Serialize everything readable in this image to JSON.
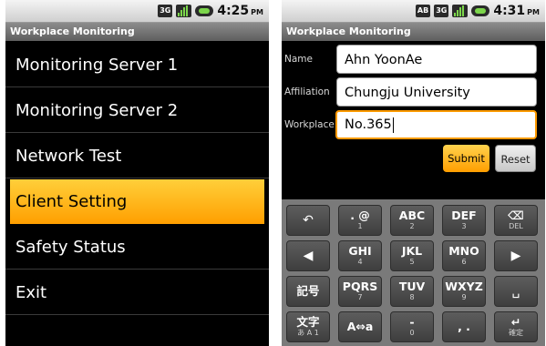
{
  "left_screen": {
    "status": {
      "network": "3G",
      "time": "4:25",
      "ampm": "PM"
    },
    "title": "Workplace Monitoring",
    "menu": [
      {
        "label": "Monitoring Server 1"
      },
      {
        "label": "Monitoring Server 2"
      },
      {
        "label": "Network Test"
      },
      {
        "label": "Client Setting",
        "selected": true
      },
      {
        "label": "Safety Status"
      },
      {
        "label": "Exit"
      }
    ]
  },
  "right_screen": {
    "status": {
      "badge": "AB",
      "network": "3G",
      "time": "4:31",
      "ampm": "PM"
    },
    "title": "Workplace Monitoring",
    "form": {
      "name_label": "Name",
      "name_value": "Ahn YoonAe",
      "affiliation_label": "Affiliation",
      "affiliation_value": "Chungju University",
      "workplace_label": "Workplace",
      "workplace_value": "No.365"
    },
    "buttons": {
      "submit": "Submit",
      "reset": "Reset"
    },
    "keyboard": {
      "row1": [
        {
          "icon": "undo-arrow-icon",
          "glyph": "↶"
        },
        {
          "main": ". @",
          "sub": "1"
        },
        {
          "main": "ABC",
          "sub": "2"
        },
        {
          "main": "DEF",
          "sub": "3"
        },
        {
          "icon": "backspace-icon",
          "glyph": "⌫",
          "sub": "DEL"
        }
      ],
      "row2": [
        {
          "icon": "cursor-left-icon",
          "glyph": "◀"
        },
        {
          "main": "GHI",
          "sub": "4"
        },
        {
          "main": "JKL",
          "sub": "5"
        },
        {
          "main": "MNO",
          "sub": "6"
        },
        {
          "icon": "cursor-right-icon",
          "glyph": "▶"
        }
      ],
      "row3": [
        {
          "main": "記号"
        },
        {
          "main": "PQRS",
          "sub": "7"
        },
        {
          "main": "TUV",
          "sub": "8"
        },
        {
          "main": "WXYZ",
          "sub": "9"
        },
        {
          "icon": "space-icon",
          "glyph": "␣"
        }
      ],
      "row4": [
        {
          "main": "文字",
          "sub": "あ A 1"
        },
        {
          "main": "A⇔a"
        },
        {
          "main": "-",
          "sub": "0"
        },
        {
          "main": ", ."
        },
        {
          "icon": "enter-icon",
          "glyph": "↵",
          "sub": "確定"
        }
      ]
    }
  },
  "colors": {
    "accent": "#ffb000",
    "focus_border": "#ff9a00",
    "battery": "#7cd64b"
  }
}
